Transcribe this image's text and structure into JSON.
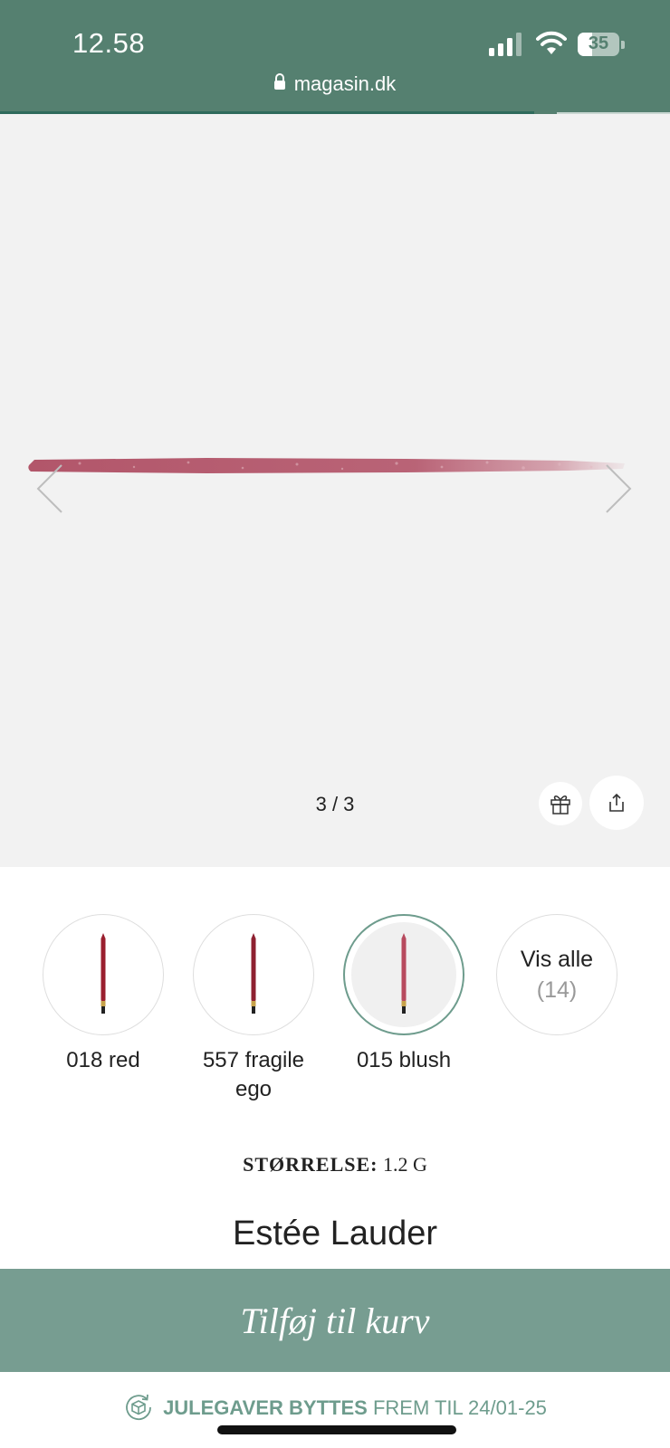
{
  "status_bar": {
    "time": "12.58",
    "battery": "35",
    "battery_level": 0.35,
    "url": "magasin.dk"
  },
  "gallery": {
    "counter": "3 / 3",
    "swatch_color": "#b2566a"
  },
  "variants": [
    {
      "label": "018 red",
      "pencil_color": "#9a1f2e",
      "selected": false
    },
    {
      "label": "557 fragile ego",
      "pencil_color": "#8e2030",
      "selected": false
    },
    {
      "label": "015 blush",
      "pencil_color": "#b74a5e",
      "selected": true
    }
  ],
  "view_all": {
    "label": "Vis alle",
    "count": "(14)"
  },
  "size": {
    "label": "STØRRELSE:",
    "value": "1.2 G"
  },
  "brand": "Estée Lauder",
  "cart_button": "Tilføj til kurv",
  "footer": {
    "bold": "JULEGAVER BYTTES",
    "rest": "FREM TIL 24/01-25"
  },
  "colors": {
    "header": "#558070",
    "accent": "#779d91",
    "footer_text": "#6e9c8d"
  }
}
